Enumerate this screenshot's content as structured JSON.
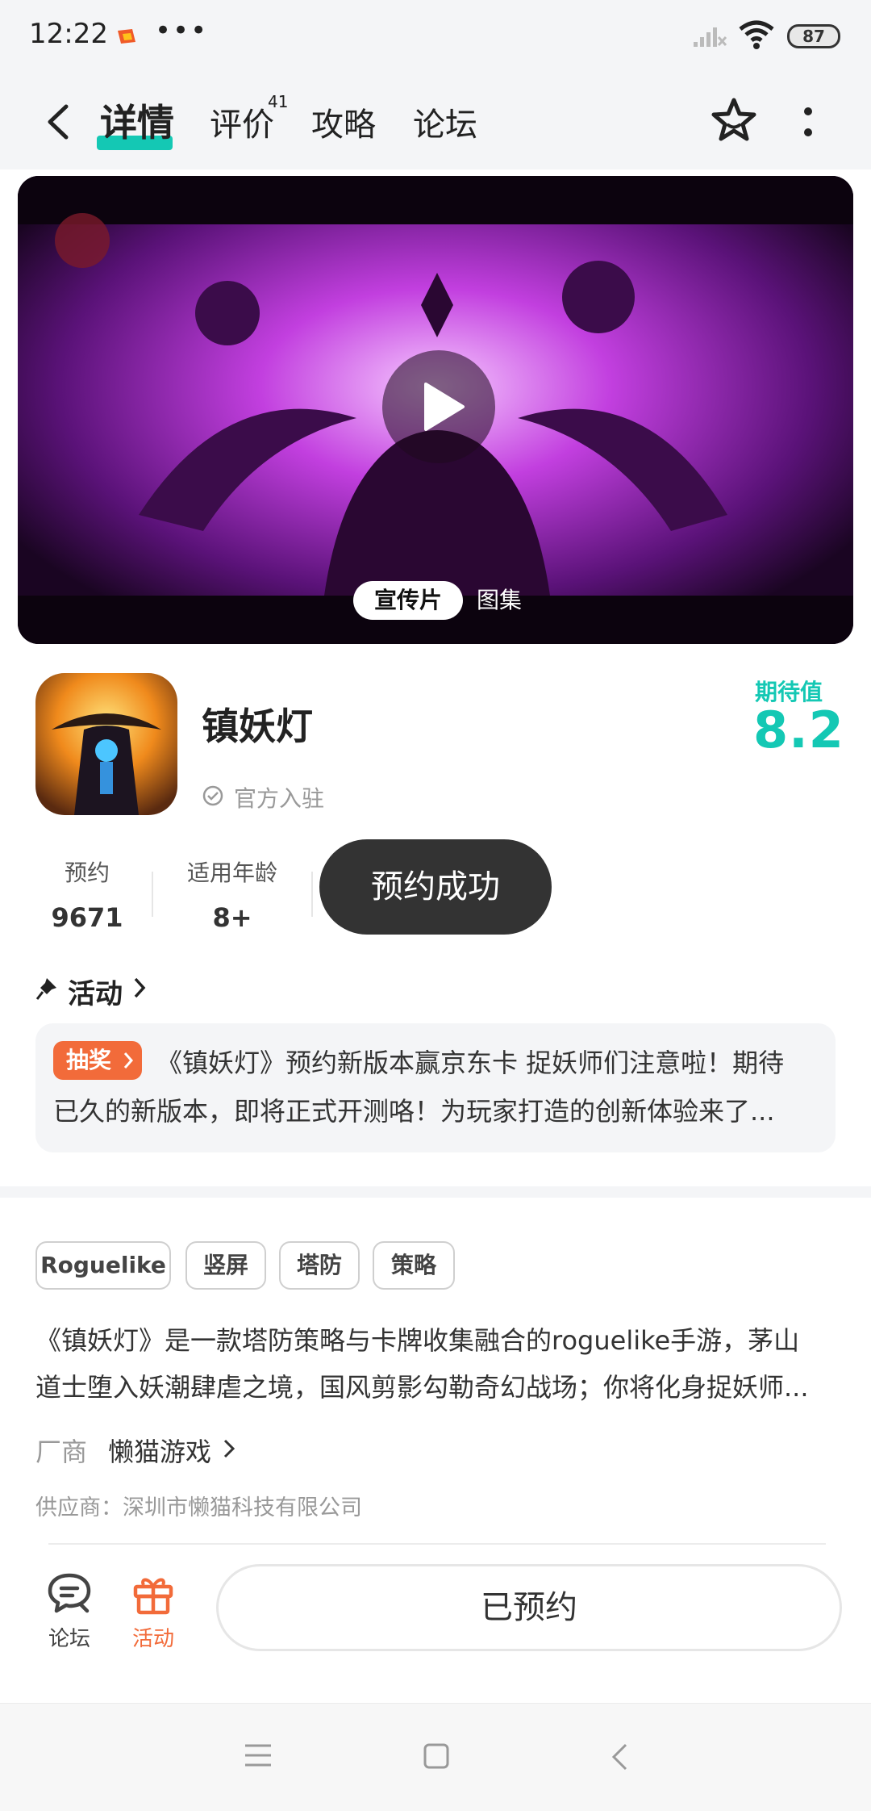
{
  "status_bar": {
    "time": "12:22",
    "dots": "•••",
    "battery": "87",
    "icons": [
      "app-icon",
      "signal-icon",
      "wifi-icon",
      "battery-icon"
    ]
  },
  "nav": {
    "tabs": [
      {
        "label": "详情",
        "active": true
      },
      {
        "label": "评价"
      },
      {
        "label": "攻略"
      },
      {
        "label": "论坛"
      }
    ],
    "review_count": "41",
    "accent_color": "#14c8b4"
  },
  "media": {
    "tabs": [
      {
        "label": "宣传片",
        "active": true
      },
      {
        "label": "图集"
      }
    ]
  },
  "game": {
    "title": "镇妖灯",
    "official": "官方入驻",
    "expect_label": "期待值",
    "expect_value": "8.2",
    "stats": {
      "reserve_label": "预约",
      "reserve_value": "9671",
      "age_label": "适用年龄",
      "age_value": "8+"
    },
    "reserved_button": "预约成功"
  },
  "activity": {
    "title": "活动",
    "badge": "抽奖",
    "line1": "《镇妖灯》预约新版本赢京东卡 捉妖师们注意啦！期待",
    "line2": "已久的新版本，即将正式开测咯！为玩家打造的创新体验来了..."
  },
  "tags": [
    "Roguelike",
    "竖屏",
    "塔防",
    "策略"
  ],
  "description": {
    "line1": "《镇妖灯》是一款塔防策略与卡牌收集融合的roguelike手游，茅山",
    "line2": "道士堕入妖潮肆虐之境，国风剪影勾勒奇幻战场；你将化身捉妖师..."
  },
  "vendor": {
    "label": "厂商",
    "name": "懒猫游戏",
    "supplier": "供应商：深圳市懒猫科技有限公司"
  },
  "action_bar": {
    "forum_label": "论坛",
    "activity_label": "活动",
    "main_button": "已预约",
    "activity_color": "#f26b3a"
  }
}
